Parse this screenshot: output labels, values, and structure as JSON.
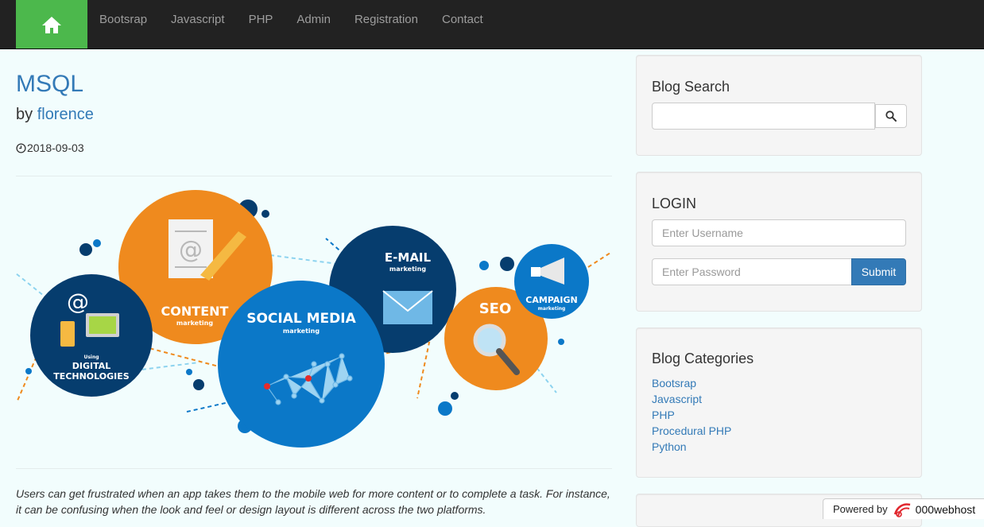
{
  "nav": {
    "home_icon": "home-icon",
    "links": [
      "Bootsrap",
      "Javascript",
      "PHP",
      "Admin",
      "Registration",
      "Contact"
    ]
  },
  "post": {
    "title": "MSQL",
    "by": "by",
    "author": "florence",
    "date": "2018-09-03",
    "text": "Users can get frustrated when an app takes them to the mobile web for more content or to complete a task. For instance, it can be confusing when the look and feel or design layout is different across the two platforms."
  },
  "hero": {
    "digital_small": "Using",
    "digital_big1": "DIGITAL",
    "digital_big2": "TECHNOLOGIES",
    "content": "CONTENT",
    "content_sub": "marketing",
    "social": "SOCIAL MEDIA",
    "social_sub": "marketing",
    "email": "E-MAIL",
    "email_sub": "marketing",
    "seo": "SEO",
    "campaign": "CAMPAIGN",
    "campaign_sub": "marketing",
    "at_symbol": "@"
  },
  "sidebar": {
    "search": {
      "title": "Blog Search",
      "placeholder": ""
    },
    "login": {
      "title": "LOGIN",
      "username_placeholder": "Enter Username",
      "password_placeholder": "Enter Password",
      "submit": "Submit"
    },
    "categories": {
      "title": "Blog Categories",
      "items": [
        "Bootsrap",
        "Javascript",
        "PHP",
        "Procedural PHP",
        "Python"
      ]
    }
  },
  "footer": {
    "powered_by": "Powered by",
    "brand": "000webhost"
  },
  "colors": {
    "navbar": "#222222",
    "home": "#4cb84c",
    "link": "#337ab7",
    "orange": "#ef8a1e",
    "blue": "#0b78c8",
    "navy": "#063d6e"
  }
}
